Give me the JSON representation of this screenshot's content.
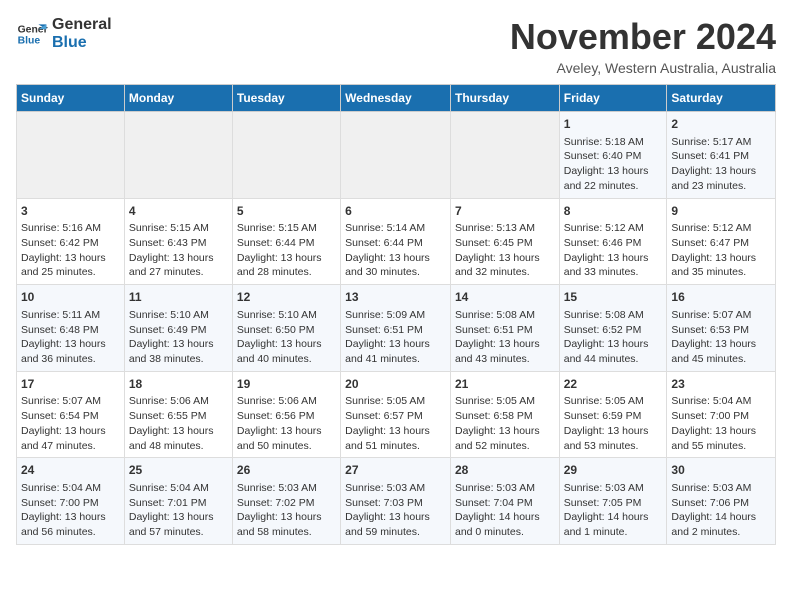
{
  "logo": {
    "line1": "General",
    "line2": "Blue"
  },
  "title": "November 2024",
  "location": "Aveley, Western Australia, Australia",
  "weekdays": [
    "Sunday",
    "Monday",
    "Tuesday",
    "Wednesday",
    "Thursday",
    "Friday",
    "Saturday"
  ],
  "weeks": [
    [
      {
        "day": "",
        "data": ""
      },
      {
        "day": "",
        "data": ""
      },
      {
        "day": "",
        "data": ""
      },
      {
        "day": "",
        "data": ""
      },
      {
        "day": "",
        "data": ""
      },
      {
        "day": "1",
        "data": "Sunrise: 5:18 AM\nSunset: 6:40 PM\nDaylight: 13 hours and 22 minutes."
      },
      {
        "day": "2",
        "data": "Sunrise: 5:17 AM\nSunset: 6:41 PM\nDaylight: 13 hours and 23 minutes."
      }
    ],
    [
      {
        "day": "3",
        "data": "Sunrise: 5:16 AM\nSunset: 6:42 PM\nDaylight: 13 hours and 25 minutes."
      },
      {
        "day": "4",
        "data": "Sunrise: 5:15 AM\nSunset: 6:43 PM\nDaylight: 13 hours and 27 minutes."
      },
      {
        "day": "5",
        "data": "Sunrise: 5:15 AM\nSunset: 6:44 PM\nDaylight: 13 hours and 28 minutes."
      },
      {
        "day": "6",
        "data": "Sunrise: 5:14 AM\nSunset: 6:44 PM\nDaylight: 13 hours and 30 minutes."
      },
      {
        "day": "7",
        "data": "Sunrise: 5:13 AM\nSunset: 6:45 PM\nDaylight: 13 hours and 32 minutes."
      },
      {
        "day": "8",
        "data": "Sunrise: 5:12 AM\nSunset: 6:46 PM\nDaylight: 13 hours and 33 minutes."
      },
      {
        "day": "9",
        "data": "Sunrise: 5:12 AM\nSunset: 6:47 PM\nDaylight: 13 hours and 35 minutes."
      }
    ],
    [
      {
        "day": "10",
        "data": "Sunrise: 5:11 AM\nSunset: 6:48 PM\nDaylight: 13 hours and 36 minutes."
      },
      {
        "day": "11",
        "data": "Sunrise: 5:10 AM\nSunset: 6:49 PM\nDaylight: 13 hours and 38 minutes."
      },
      {
        "day": "12",
        "data": "Sunrise: 5:10 AM\nSunset: 6:50 PM\nDaylight: 13 hours and 40 minutes."
      },
      {
        "day": "13",
        "data": "Sunrise: 5:09 AM\nSunset: 6:51 PM\nDaylight: 13 hours and 41 minutes."
      },
      {
        "day": "14",
        "data": "Sunrise: 5:08 AM\nSunset: 6:51 PM\nDaylight: 13 hours and 43 minutes."
      },
      {
        "day": "15",
        "data": "Sunrise: 5:08 AM\nSunset: 6:52 PM\nDaylight: 13 hours and 44 minutes."
      },
      {
        "day": "16",
        "data": "Sunrise: 5:07 AM\nSunset: 6:53 PM\nDaylight: 13 hours and 45 minutes."
      }
    ],
    [
      {
        "day": "17",
        "data": "Sunrise: 5:07 AM\nSunset: 6:54 PM\nDaylight: 13 hours and 47 minutes."
      },
      {
        "day": "18",
        "data": "Sunrise: 5:06 AM\nSunset: 6:55 PM\nDaylight: 13 hours and 48 minutes."
      },
      {
        "day": "19",
        "data": "Sunrise: 5:06 AM\nSunset: 6:56 PM\nDaylight: 13 hours and 50 minutes."
      },
      {
        "day": "20",
        "data": "Sunrise: 5:05 AM\nSunset: 6:57 PM\nDaylight: 13 hours and 51 minutes."
      },
      {
        "day": "21",
        "data": "Sunrise: 5:05 AM\nSunset: 6:58 PM\nDaylight: 13 hours and 52 minutes."
      },
      {
        "day": "22",
        "data": "Sunrise: 5:05 AM\nSunset: 6:59 PM\nDaylight: 13 hours and 53 minutes."
      },
      {
        "day": "23",
        "data": "Sunrise: 5:04 AM\nSunset: 7:00 PM\nDaylight: 13 hours and 55 minutes."
      }
    ],
    [
      {
        "day": "24",
        "data": "Sunrise: 5:04 AM\nSunset: 7:00 PM\nDaylight: 13 hours and 56 minutes."
      },
      {
        "day": "25",
        "data": "Sunrise: 5:04 AM\nSunset: 7:01 PM\nDaylight: 13 hours and 57 minutes."
      },
      {
        "day": "26",
        "data": "Sunrise: 5:03 AM\nSunset: 7:02 PM\nDaylight: 13 hours and 58 minutes."
      },
      {
        "day": "27",
        "data": "Sunrise: 5:03 AM\nSunset: 7:03 PM\nDaylight: 13 hours and 59 minutes."
      },
      {
        "day": "28",
        "data": "Sunrise: 5:03 AM\nSunset: 7:04 PM\nDaylight: 14 hours and 0 minutes."
      },
      {
        "day": "29",
        "data": "Sunrise: 5:03 AM\nSunset: 7:05 PM\nDaylight: 14 hours and 1 minute."
      },
      {
        "day": "30",
        "data": "Sunrise: 5:03 AM\nSunset: 7:06 PM\nDaylight: 14 hours and 2 minutes."
      }
    ]
  ]
}
